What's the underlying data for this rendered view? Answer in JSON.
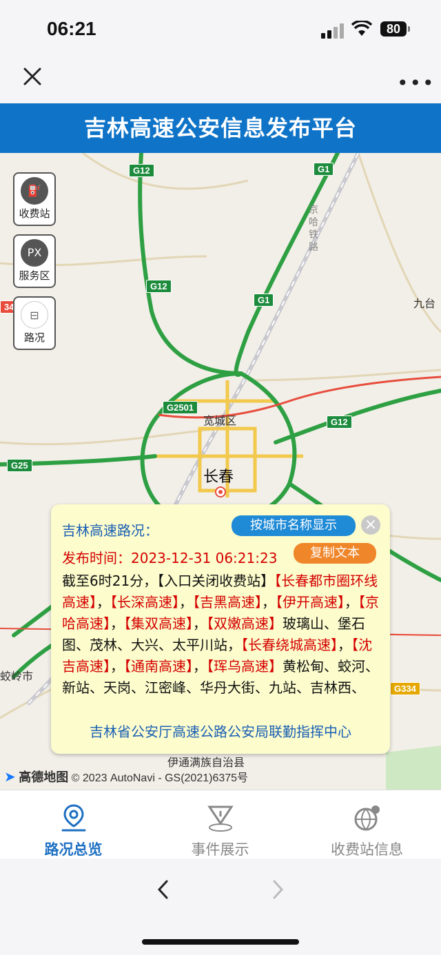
{
  "status": {
    "time": "06:21",
    "battery": "80"
  },
  "header": {
    "title": "吉林高速公安信息发布平台"
  },
  "side_buttons": [
    {
      "label": "收费站",
      "icon": "toll-station-icon"
    },
    {
      "label": "服务区",
      "icon": "service-area-icon",
      "icon_text": "PX"
    },
    {
      "label": "路况",
      "icon": "road-condition-icon"
    }
  ],
  "map": {
    "shields": [
      "G12",
      "G1",
      "G12",
      "G1",
      "G2501",
      "G12",
      "G25",
      "G334",
      "34"
    ],
    "labels": {
      "district": "宽城区",
      "city": "长春",
      "jiutai": "九台",
      "jiaolingshi": "蛟岭市",
      "county": "伊通满族自治县",
      "railway": "京哈铁路"
    },
    "attribution_logo": "高德地图",
    "attribution": "© 2023 AutoNavi - GS(2021)6375号"
  },
  "popup": {
    "title": "吉林高速路况：",
    "city_button": "按城市名称显示",
    "close": "×",
    "publish_label": "发布时间：",
    "publish_time": "2023-12-31 06:21:23",
    "copy_button": "复制文本",
    "body": [
      {
        "t": "截至6时21分，【入口关闭收费站】",
        "hl": false
      },
      {
        "t": "【长春都市圈环线高速】",
        "hl": true
      },
      {
        "t": "，",
        "hl": false
      },
      {
        "t": "【长深高速】",
        "hl": true
      },
      {
        "t": "，",
        "hl": false
      },
      {
        "t": "【吉黑高速】",
        "hl": true
      },
      {
        "t": "，",
        "hl": false
      },
      {
        "t": "【伊开高速】",
        "hl": true
      },
      {
        "t": "，",
        "hl": false
      },
      {
        "t": "【京哈高速】",
        "hl": true
      },
      {
        "t": "，",
        "hl": false
      },
      {
        "t": "【集双高速】",
        "hl": true
      },
      {
        "t": "，",
        "hl": false
      },
      {
        "t": "【双嫩高速】",
        "hl": true
      },
      {
        "t": "玻璃山、堡石图、茂林、大兴、太平川站，",
        "hl": false
      },
      {
        "t": "【长春绕城高速】",
        "hl": true
      },
      {
        "t": "，",
        "hl": false
      },
      {
        "t": "【沈吉高速】",
        "hl": true
      },
      {
        "t": "，",
        "hl": false
      },
      {
        "t": "【通南高速】",
        "hl": true
      },
      {
        "t": "，",
        "hl": false
      },
      {
        "t": "【珲乌高速】",
        "hl": true
      },
      {
        "t": "黄松甸、蛟河、新站、天岗、江密峰、华丹大街、九站、吉林西、",
        "hl": false
      }
    ],
    "footer": "吉林省公安厅高速公路公安局联勤指挥中心"
  },
  "tabs": [
    {
      "label": "路况总览",
      "icon": "location-icon",
      "active": true
    },
    {
      "label": "事件展示",
      "icon": "warning-sign-icon",
      "active": false
    },
    {
      "label": "收费站信息",
      "icon": "globe-pin-icon",
      "active": false
    }
  ],
  "colors": {
    "header": "#0f74c8",
    "active_tab": "#1d6fc2",
    "highlight": "#d50000"
  }
}
